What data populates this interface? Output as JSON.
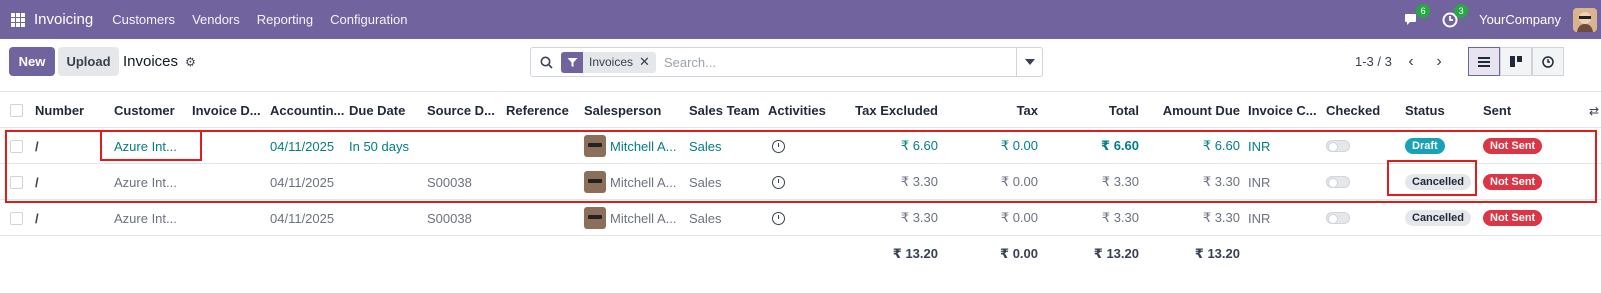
{
  "navbar": {
    "brand": "Invoicing",
    "menu": [
      "Customers",
      "Vendors",
      "Reporting",
      "Configuration"
    ],
    "messages_count": "6",
    "activities_count": "3",
    "company": "YourCompany"
  },
  "control": {
    "new_label": "New",
    "upload_label": "Upload",
    "breadcrumb": "Invoices",
    "facet_label": "Invoices",
    "search_placeholder": "Search...",
    "pager": "1-3 / 3"
  },
  "columns": [
    "Number",
    "Customer",
    "Invoice D...",
    "Accountin...",
    "Due Date",
    "Source D...",
    "Reference",
    "Salesperson",
    "Sales Team",
    "Activities",
    "Tax Excluded",
    "Tax",
    "Total",
    "Amount Due",
    "Invoice C...",
    "Checked",
    "Status",
    "Sent"
  ],
  "rows": [
    {
      "number": "/",
      "customer": "Azure Int...",
      "invoice_date": "",
      "accounting_date": "04/11/2025",
      "due_date": "In 50 days",
      "source": "",
      "reference": "",
      "salesperson": "Mitchell A...",
      "team": "Sales",
      "tax_excluded": "₹ 6.60",
      "tax": "₹ 0.00",
      "total": "₹ 6.60",
      "amount_due": "₹ 6.60",
      "currency": "INR",
      "status": "Draft",
      "sent": "Not Sent"
    },
    {
      "number": "/",
      "customer": "Azure Int...",
      "invoice_date": "",
      "accounting_date": "04/11/2025",
      "due_date": "",
      "source": "S00038",
      "reference": "",
      "salesperson": "Mitchell A...",
      "team": "Sales",
      "tax_excluded": "₹ 3.30",
      "tax": "₹ 0.00",
      "total": "₹ 3.30",
      "amount_due": "₹ 3.30",
      "currency": "INR",
      "status": "Cancelled",
      "sent": "Not Sent"
    },
    {
      "number": "/",
      "customer": "Azure Int...",
      "invoice_date": "",
      "accounting_date": "04/11/2025",
      "due_date": "",
      "source": "S00038",
      "reference": "",
      "salesperson": "Mitchell A...",
      "team": "Sales",
      "tax_excluded": "₹ 3.30",
      "tax": "₹ 0.00",
      "total": "₹ 3.30",
      "amount_due": "₹ 3.30",
      "currency": "INR",
      "status": "Cancelled",
      "sent": "Not Sent"
    }
  ],
  "totals": {
    "tax_excluded": "₹ 13.20",
    "tax": "₹ 0.00",
    "total": "₹ 13.20",
    "amount_due": "₹ 13.20"
  },
  "colors": {
    "brand": "#71639e",
    "link": "#017e84",
    "highlight": "#e21b1b"
  }
}
